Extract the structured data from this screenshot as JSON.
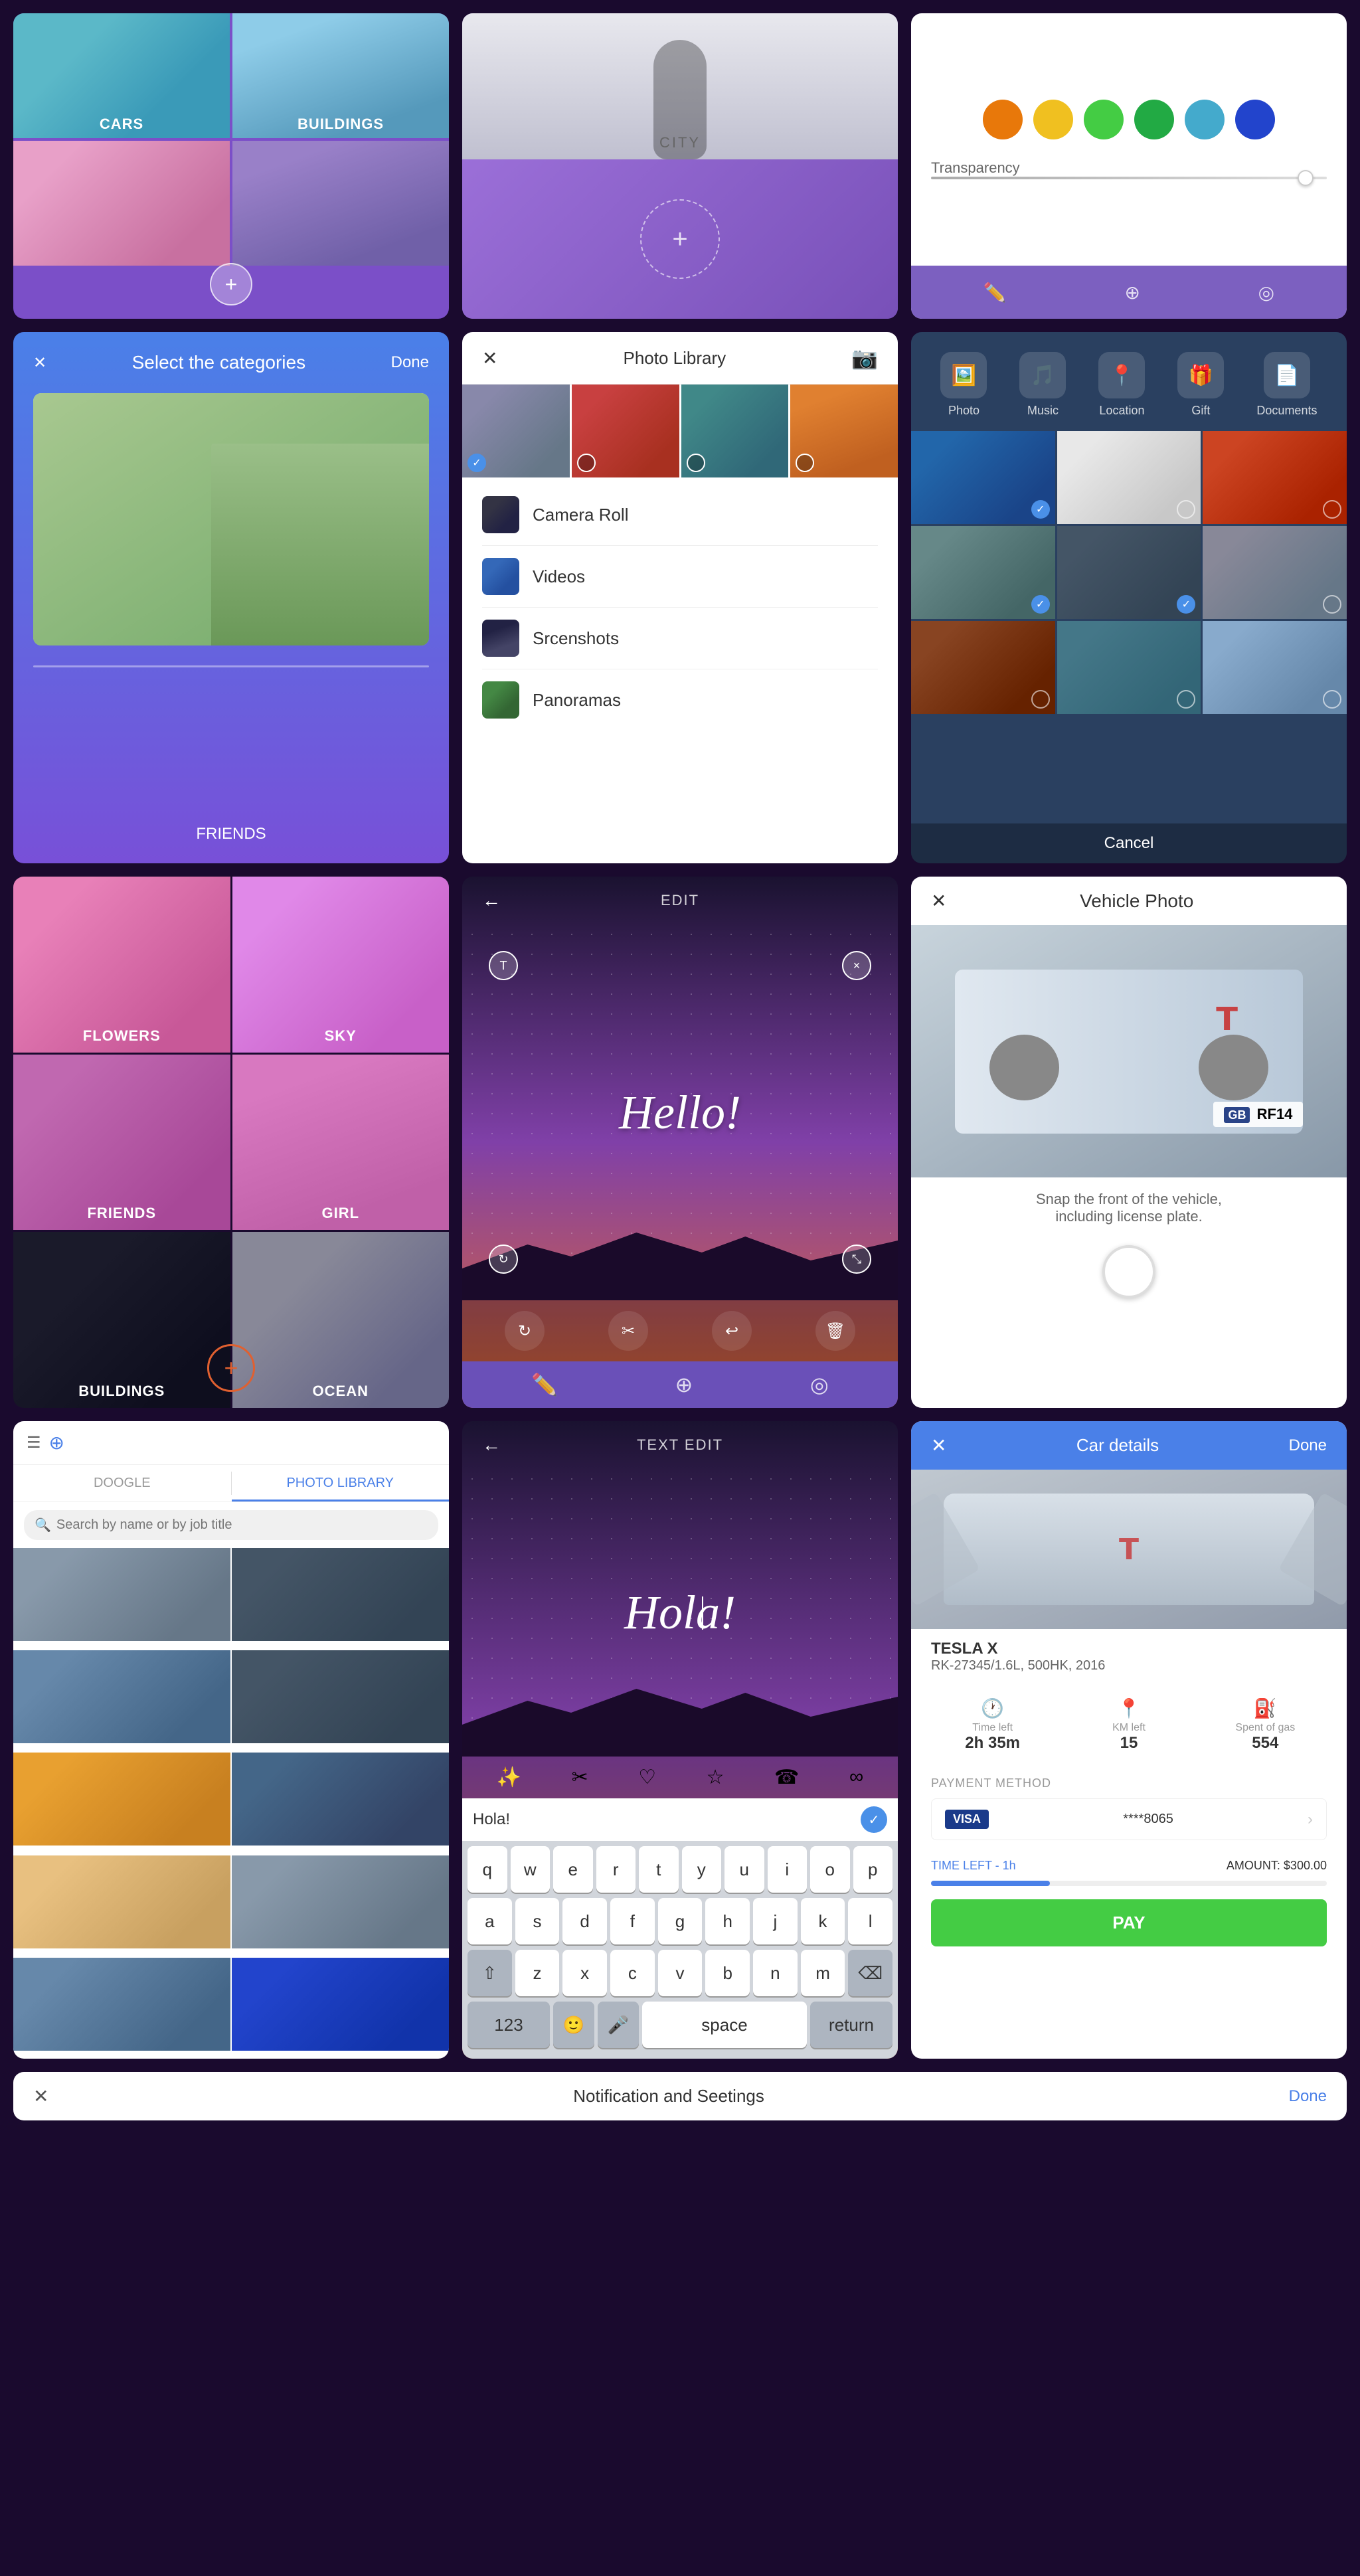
{
  "panel1": {
    "cells": [
      {
        "label": "CARS",
        "bg": "car-img"
      },
      {
        "label": "BUILDINGS",
        "bg": "building-img"
      },
      {
        "label": "",
        "bg": "pink-flowers"
      },
      {
        "label": "",
        "bg": "person-img"
      }
    ],
    "add_button": "+"
  },
  "panel2": {
    "city_label": "CITY",
    "add_button": "+"
  },
  "panel3": {
    "colors": [
      {
        "hex": "#e8780a"
      },
      {
        "hex": "#f0c020"
      },
      {
        "hex": "#44cc44"
      },
      {
        "hex": "#22aa44"
      },
      {
        "hex": "#44aacc"
      },
      {
        "hex": "#2244cc"
      }
    ],
    "transparency_label": "Transparency",
    "icons": [
      "✏️",
      "⊕",
      "◎"
    ]
  },
  "panel4": {
    "close": "✕",
    "title": "Select the categories",
    "done": "Done",
    "bottom_label": "FRIENDS"
  },
  "panel5": {
    "title": "Photo Library",
    "camera_icon": "📷",
    "items": [
      {
        "label": "Camera Roll",
        "bg": "thumb-camera"
      },
      {
        "label": "Videos",
        "bg": "thumb-videos"
      },
      {
        "label": "Srcenshots",
        "bg": "thumb-screenshots"
      },
      {
        "label": "Panoramas",
        "bg": "thumb-panoramas"
      }
    ],
    "strip_checks": [
      true,
      false,
      false,
      false
    ]
  },
  "panel6": {
    "icons": [
      {
        "label": "Photo",
        "icon": "🖼️"
      },
      {
        "label": "Music",
        "icon": "🎵"
      },
      {
        "label": "Location",
        "icon": "📍"
      },
      {
        "label": "Gift",
        "icon": "🎁"
      },
      {
        "label": "Documents",
        "icon": "📄"
      }
    ],
    "cancel": "Cancel"
  },
  "panel7": {
    "cells": [
      {
        "label": "FLOWERS",
        "bg": "flowers-bg"
      },
      {
        "label": "SKY",
        "bg": "sky-bg"
      },
      {
        "label": "FRIENDS",
        "bg": "friends-bg"
      },
      {
        "label": "GIRL",
        "bg": "girl-bg"
      },
      {
        "label": "BUILDINGS",
        "bg": "buildings-bg2"
      },
      {
        "label": "OCEAN",
        "bg": "ocean-bg"
      }
    ],
    "add_button": "+"
  },
  "panel8": {
    "back": "←",
    "title": "EDIT",
    "hello_text": "Hello!",
    "tl_handle": "T",
    "tr_handle": "×"
  },
  "panel9": {
    "close": "✕",
    "title": "Vehicle Photo",
    "plate": "RF14",
    "snap_label": "Snap the front of the vehicle,\nincluding license plate."
  },
  "panel10": {
    "hamburger": "☰",
    "doogle_label": "⊕",
    "tab1": "DOOGLE",
    "tab2": "PHOTO LIBRARY",
    "search_placeholder": "Search by name or by job title"
  },
  "panel11": {
    "back": "←",
    "title": "TEXT EDIT",
    "hola_text": "Hola!",
    "input_text": "Hola!",
    "keyboard_rows": [
      [
        "q",
        "w",
        "e",
        "r",
        "t",
        "y",
        "u",
        "i",
        "o",
        "p"
      ],
      [
        "a",
        "s",
        "d",
        "f",
        "g",
        "h",
        "j",
        "k",
        "l"
      ],
      [
        "⇧",
        "z",
        "x",
        "c",
        "v",
        "b",
        "n",
        "m",
        "⌫"
      ],
      [
        "123",
        "🙂",
        "🎤",
        "space",
        "return"
      ]
    ]
  },
  "panel12": {
    "close": "✕",
    "title": "Car details",
    "done": "Done",
    "car_name": "TESLA X",
    "car_reg": "RK-27345/1.6L, 500HK, 2016",
    "stats": [
      {
        "label": "Time left",
        "value": "2h 35m",
        "icon": "🕐"
      },
      {
        "label": "KM left",
        "value": "15",
        "icon": "📍"
      },
      {
        "label": "Spent of gas",
        "value": "554",
        "icon": "⛽"
      }
    ],
    "payment_label": "PAYMENT METHOD",
    "visa_label": "VISA",
    "card_number": "****8065",
    "time_left_label": "TIME LEFT - 1h",
    "amount_label": "AMOUNT: $300.00",
    "pay_label": "PAY"
  },
  "panel13": {
    "close": "✕",
    "title": "Notification and Seetings",
    "done": "Done"
  }
}
